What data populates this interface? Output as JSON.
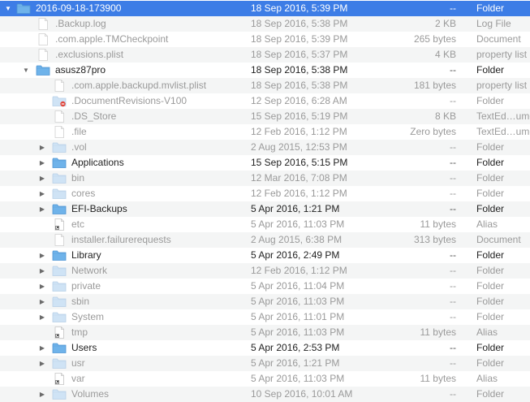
{
  "rows": [
    {
      "name": "2016-09-18-173900",
      "date": "18 Sep 2016, 5:39 PM",
      "size": "--",
      "kind": "Folder",
      "level": 0,
      "icon": "folder-icon",
      "disclosure": "expanded",
      "dim": false,
      "selected": true
    },
    {
      "name": ".Backup.log",
      "date": "18 Sep 2016, 5:38 PM",
      "size": "2 KB",
      "kind": "Log File",
      "level": 1,
      "icon": "document-icon",
      "disclosure": "none",
      "dim": true,
      "selected": false
    },
    {
      "name": ".com.apple.TMCheckpoint",
      "date": "18 Sep 2016, 5:39 PM",
      "size": "265 bytes",
      "kind": "Document",
      "level": 1,
      "icon": "document-icon",
      "disclosure": "none",
      "dim": true,
      "selected": false
    },
    {
      "name": ".exclusions.plist",
      "date": "18 Sep 2016, 5:37 PM",
      "size": "4 KB",
      "kind": "property list",
      "level": 1,
      "icon": "document-icon",
      "disclosure": "none",
      "dim": true,
      "selected": false
    },
    {
      "name": "asusz87pro",
      "date": "18 Sep 2016, 5:38 PM",
      "size": "--",
      "kind": "Folder",
      "level": 1,
      "icon": "folder-icon",
      "disclosure": "expanded",
      "dim": false,
      "selected": false
    },
    {
      "name": ".com.apple.backupd.mvlist.plist",
      "date": "18 Sep 2016, 5:38 PM",
      "size": "181 bytes",
      "kind": "property list",
      "level": 2,
      "icon": "document-icon",
      "disclosure": "none",
      "dim": true,
      "selected": false
    },
    {
      "name": ".DocumentRevisions-V100",
      "date": "12 Sep 2016, 6:28 AM",
      "size": "--",
      "kind": "Folder",
      "level": 2,
      "icon": "locked-folder-icon",
      "disclosure": "none",
      "dim": true,
      "selected": false
    },
    {
      "name": ".DS_Store",
      "date": "15 Sep 2016, 5:19 PM",
      "size": "8 KB",
      "kind": "TextEd…ument",
      "level": 2,
      "icon": "document-icon",
      "disclosure": "none",
      "dim": true,
      "selected": false
    },
    {
      "name": ".file",
      "date": "12 Feb 2016, 1:12 PM",
      "size": "Zero bytes",
      "kind": "TextEd…ument",
      "level": 2,
      "icon": "document-icon",
      "disclosure": "none",
      "dim": true,
      "selected": false
    },
    {
      "name": ".vol",
      "date": "2 Aug 2015, 12:53 PM",
      "size": "--",
      "kind": "Folder",
      "level": 2,
      "icon": "folder-icon",
      "disclosure": "collapsed",
      "dim": true,
      "selected": false
    },
    {
      "name": "Applications",
      "date": "15 Sep 2016, 5:15 PM",
      "size": "--",
      "kind": "Folder",
      "level": 2,
      "icon": "folder-icon",
      "disclosure": "collapsed",
      "dim": false,
      "selected": false
    },
    {
      "name": "bin",
      "date": "12 Mar 2016, 7:08 PM",
      "size": "--",
      "kind": "Folder",
      "level": 2,
      "icon": "folder-icon",
      "disclosure": "collapsed",
      "dim": true,
      "selected": false
    },
    {
      "name": "cores",
      "date": "12 Feb 2016, 1:12 PM",
      "size": "--",
      "kind": "Folder",
      "level": 2,
      "icon": "folder-icon",
      "disclosure": "collapsed",
      "dim": true,
      "selected": false
    },
    {
      "name": "EFI-Backups",
      "date": "5 Apr 2016, 1:21 PM",
      "size": "--",
      "kind": "Folder",
      "level": 2,
      "icon": "folder-icon",
      "disclosure": "collapsed",
      "dim": false,
      "selected": false
    },
    {
      "name": "etc",
      "date": "5 Apr 2016, 11:03 PM",
      "size": "11 bytes",
      "kind": "Alias",
      "level": 2,
      "icon": "alias-icon",
      "disclosure": "none",
      "dim": true,
      "selected": false
    },
    {
      "name": "installer.failurerequests",
      "date": "2 Aug 2015, 6:38 PM",
      "size": "313 bytes",
      "kind": "Document",
      "level": 2,
      "icon": "document-icon",
      "disclosure": "none",
      "dim": true,
      "selected": false
    },
    {
      "name": "Library",
      "date": "5 Apr 2016, 2:49 PM",
      "size": "--",
      "kind": "Folder",
      "level": 2,
      "icon": "folder-icon",
      "disclosure": "collapsed",
      "dim": false,
      "selected": false
    },
    {
      "name": "Network",
      "date": "12 Feb 2016, 1:12 PM",
      "size": "--",
      "kind": "Folder",
      "level": 2,
      "icon": "folder-icon",
      "disclosure": "collapsed",
      "dim": true,
      "selected": false
    },
    {
      "name": "private",
      "date": "5 Apr 2016, 11:04 PM",
      "size": "--",
      "kind": "Folder",
      "level": 2,
      "icon": "folder-icon",
      "disclosure": "collapsed",
      "dim": true,
      "selected": false
    },
    {
      "name": "sbin",
      "date": "5 Apr 2016, 11:03 PM",
      "size": "--",
      "kind": "Folder",
      "level": 2,
      "icon": "folder-icon",
      "disclosure": "collapsed",
      "dim": true,
      "selected": false
    },
    {
      "name": "System",
      "date": "5 Apr 2016, 11:01 PM",
      "size": "--",
      "kind": "Folder",
      "level": 2,
      "icon": "folder-icon",
      "disclosure": "collapsed",
      "dim": true,
      "selected": false
    },
    {
      "name": "tmp",
      "date": "5 Apr 2016, 11:03 PM",
      "size": "11 bytes",
      "kind": "Alias",
      "level": 2,
      "icon": "alias-icon",
      "disclosure": "none",
      "dim": true,
      "selected": false
    },
    {
      "name": "Users",
      "date": "5 Apr 2016, 2:53 PM",
      "size": "--",
      "kind": "Folder",
      "level": 2,
      "icon": "folder-icon",
      "disclosure": "collapsed",
      "dim": false,
      "selected": false
    },
    {
      "name": "usr",
      "date": "5 Apr 2016, 1:21 PM",
      "size": "--",
      "kind": "Folder",
      "level": 2,
      "icon": "folder-icon",
      "disclosure": "collapsed",
      "dim": true,
      "selected": false
    },
    {
      "name": "var",
      "date": "5 Apr 2016, 11:03 PM",
      "size": "11 bytes",
      "kind": "Alias",
      "level": 2,
      "icon": "alias-icon",
      "disclosure": "none",
      "dim": true,
      "selected": false
    },
    {
      "name": "Volumes",
      "date": "10 Sep 2016, 10:01 AM",
      "size": "--",
      "kind": "Folder",
      "level": 2,
      "icon": "folder-icon",
      "disclosure": "collapsed",
      "dim": true,
      "selected": false
    }
  ],
  "colors": {
    "selection": "#3d7de6",
    "folder": "#6fb3ea",
    "folder_dim": "#cfe3f5",
    "stripe": "#f4f5f5",
    "lock_badge": "#e0483e"
  }
}
